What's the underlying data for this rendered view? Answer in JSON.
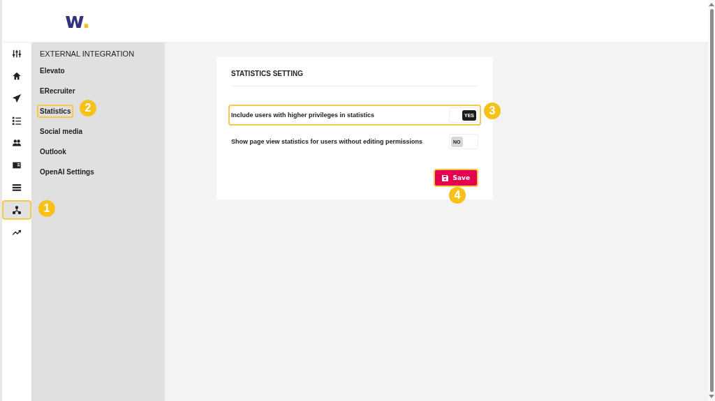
{
  "logo": {
    "letter": "w",
    "dot": "."
  },
  "nav_rail": [
    {
      "highlighted": false
    },
    {
      "highlighted": false
    },
    {
      "highlighted": false
    },
    {
      "highlighted": false
    },
    {
      "highlighted": false
    },
    {
      "highlighted": false
    },
    {
      "highlighted": false
    },
    {
      "highlighted": true
    },
    {
      "highlighted": false
    }
  ],
  "submenu": {
    "title": "EXTERNAL INTEGRATION",
    "items": [
      {
        "label": "Elevato",
        "highlighted": false
      },
      {
        "label": "ERecruiter",
        "highlighted": false
      },
      {
        "label": "Statistics",
        "highlighted": true
      },
      {
        "label": "Social media",
        "highlighted": false
      },
      {
        "label": "Outlook",
        "highlighted": false
      },
      {
        "label": "OpenAI Settings",
        "highlighted": false
      }
    ]
  },
  "card": {
    "title": "STATISTICS SETTING",
    "settings": [
      {
        "label": "Include users with higher privileges in statistics",
        "on": true,
        "toggle_text": "YES",
        "highlighted": true
      },
      {
        "label": "Show page view statistics for users without editing permissions",
        "on": false,
        "toggle_text": "NO",
        "highlighted": false
      }
    ],
    "save_button": {
      "label": "Save",
      "highlighted": true
    }
  },
  "callouts": [
    "1",
    "2",
    "3",
    "4"
  ]
}
